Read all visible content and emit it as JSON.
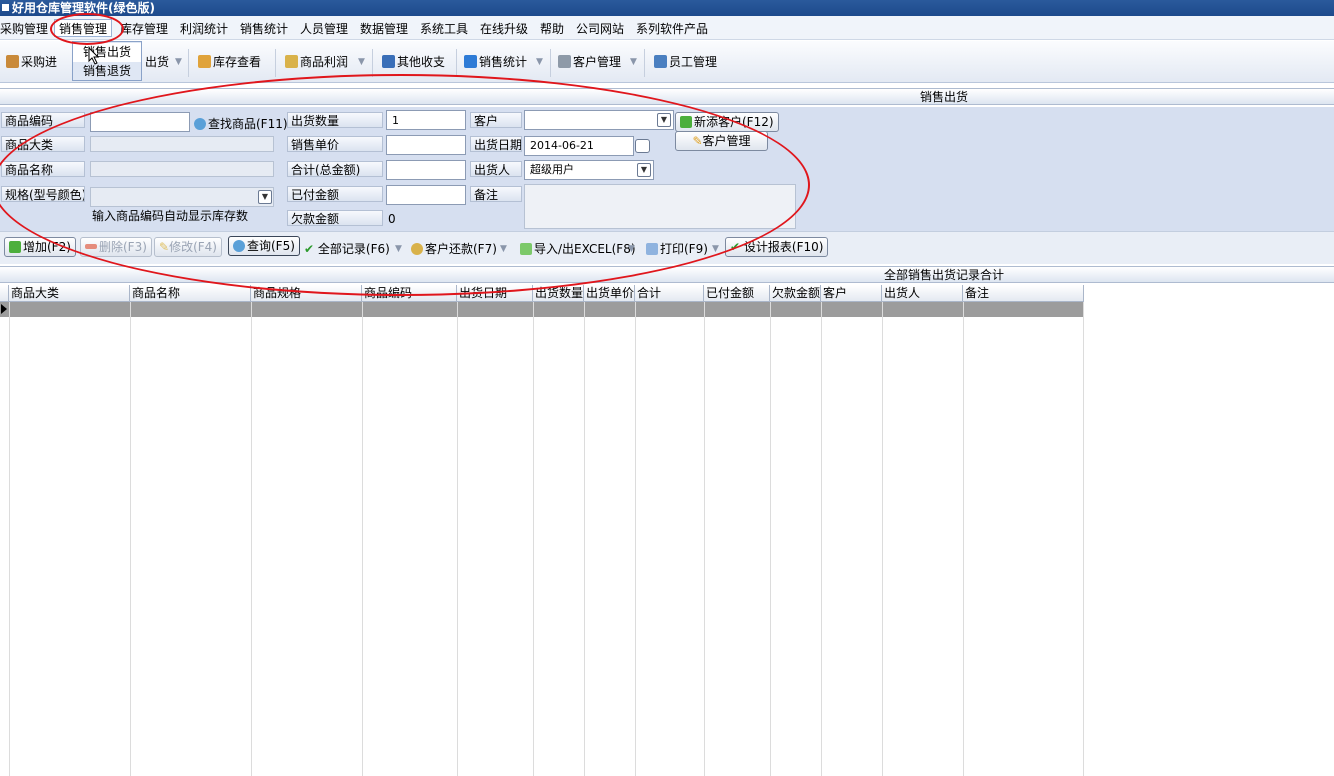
{
  "window": {
    "title": "好用仓库管理软件(绿色版)"
  },
  "menu": {
    "items": [
      "采购管理",
      "销售管理",
      "库存管理",
      "利润统计",
      "销售统计",
      "人员管理",
      "数据管理",
      "系统工具",
      "在线升级",
      "帮助",
      "公司网站",
      "系列软件产品"
    ],
    "dropdown": [
      "销售出货",
      "销售退货"
    ]
  },
  "toolbar": {
    "caigou": "采购进",
    "chuhuo": "出货",
    "kucun": "库存查看",
    "lirun": "商品利润",
    "shouzhi": "其他收支",
    "tongji": "销售统计",
    "kehu": "客户管理",
    "yuangong": "员工管理"
  },
  "section": {
    "title": "销售出货"
  },
  "form": {
    "code_label": "商品编码",
    "category_label": "商品大类",
    "name_label": "商品名称",
    "spec_label": "规格(型号颜色)",
    "find_button": "查找商品(F11)",
    "hint": "输入商品编码自动显示库存数",
    "qty_label": "出货数量",
    "qty_value": "1",
    "price_label": "销售单价",
    "total_label": "合计(总金额)",
    "paid_label": "已付金额",
    "owed_label": "欠款金额",
    "owed_value": "0",
    "customer_label": "客户",
    "date_label": "出货日期",
    "date_value": "2014-06-21",
    "shipper_label": "出货人",
    "shipper_value": "超级用户",
    "note_label": "备注",
    "new_customer_button": "新添客户(F12)",
    "customer_mgmt_button": "客户管理"
  },
  "actions": {
    "add": "增加(F2)",
    "delete": "删除(F3)",
    "edit": "修改(F4)",
    "query": "查询(F5)",
    "all": "全部记录(F6)",
    "repay": "客户还款(F7)",
    "excel": "导入/出EXCEL(F8)",
    "print": "打印(F9)",
    "report": "设计报表(F10)"
  },
  "records": {
    "title": "全部销售出货记录合计",
    "columns": [
      "商品大类",
      "商品名称",
      "商品规格",
      "商品编码",
      "出货日期",
      "出货数量",
      "出货单价",
      "合计",
      "已付金额",
      "欠款金额",
      "客户",
      "出货人",
      "备注"
    ]
  },
  "colors": {
    "titlebar": "#1d4a8c",
    "form_bg": "#d6dff0",
    "annotation": "#e0161c",
    "selected_row": "#9c9c9c"
  }
}
